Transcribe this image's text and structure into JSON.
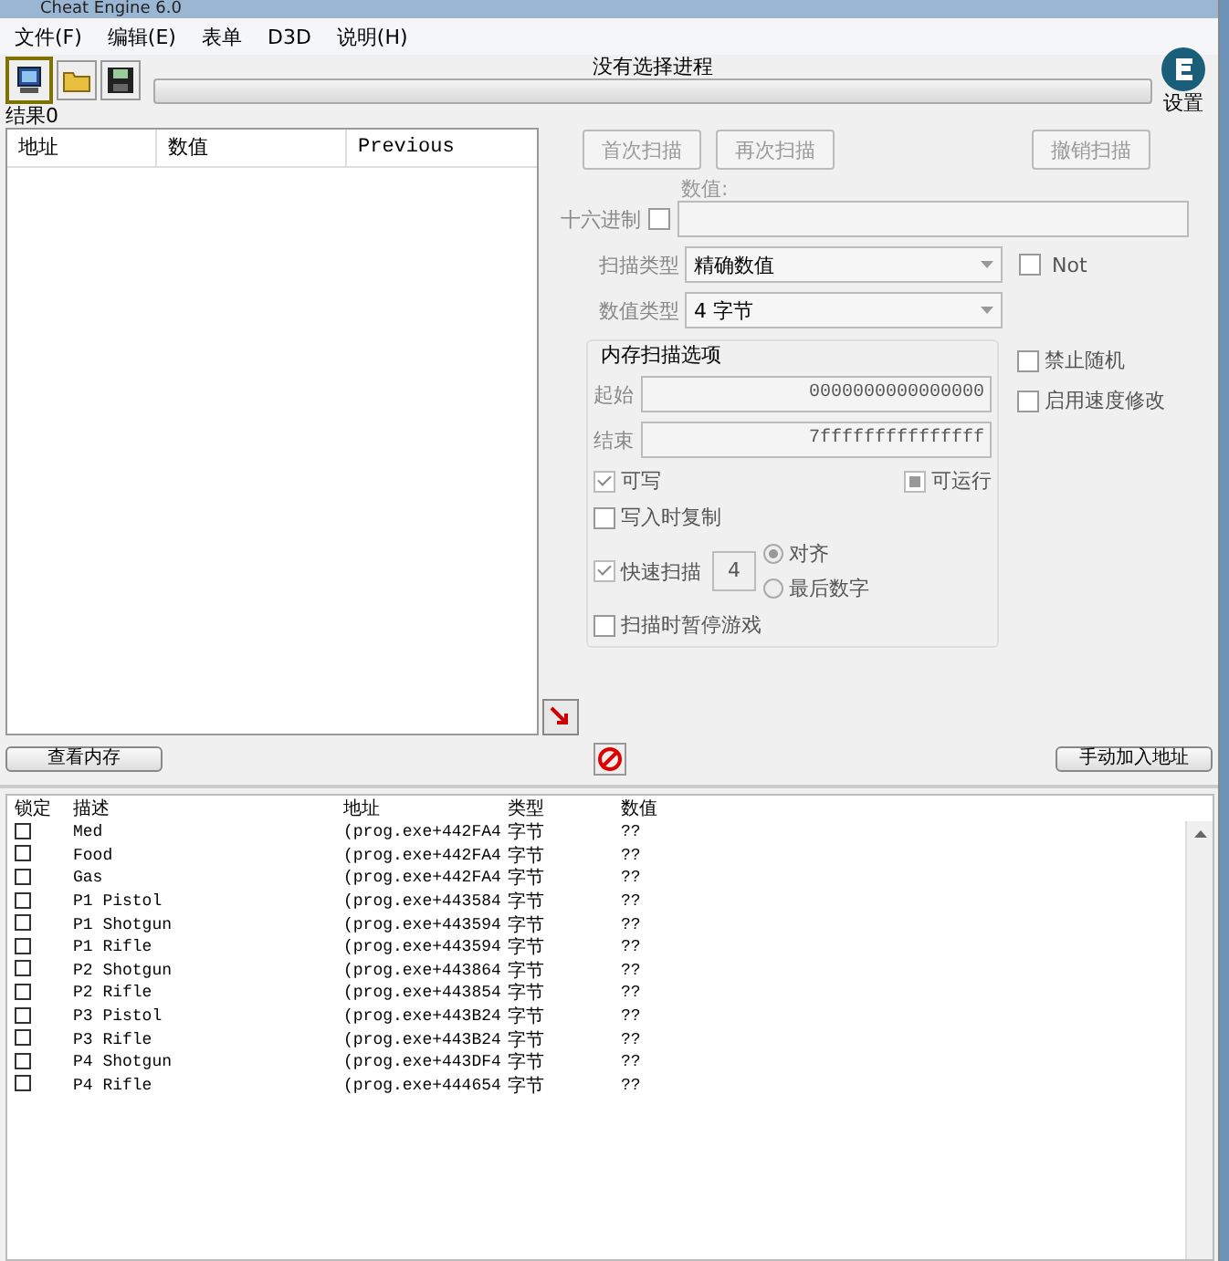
{
  "window": {
    "title": "Cheat Engine 6.0"
  },
  "menu": [
    "文件(F)",
    "编辑(E)",
    "表单",
    "D3D",
    "说明(H)"
  ],
  "process_label": "没有选择进程",
  "settings_label": "设置",
  "results_label": "结果0",
  "found_list": {
    "columns": [
      "地址",
      "数值",
      "Previous"
    ]
  },
  "scan_buttons": [
    {
      "label": "首次扫描",
      "disabled": true
    },
    {
      "label": "再次扫描",
      "disabled": true
    },
    {
      "label": "撤销扫描",
      "disabled": true
    }
  ],
  "value": {
    "label": "数值:"
  },
  "progress": {
    "level": 0
  },
  "hex": {
    "label": "十六进制",
    "checked": false
  },
  "scan_type": {
    "label": "扫描类型",
    "value": "精确数值"
  },
  "not_option": {
    "label": "Not",
    "checked": false
  },
  "value_type": {
    "label": "数值类型",
    "value": "4 字节"
  },
  "memory_options": {
    "title": "内存扫描选项",
    "start_label": "起始",
    "start": "0000000000000000",
    "end_label": "结束",
    "end": "7fffffffffffffff",
    "writable": {
      "label": "可写",
      "checked": true
    },
    "executable": {
      "label": "可运行",
      "indeterminate": true
    },
    "copy_on_write": {
      "label": "写入时复制",
      "checked": false
    },
    "fast_scan": {
      "label": "快速扫描",
      "checked": true,
      "value": "4"
    },
    "alignment": [
      {
        "label": "对齐",
        "selected": true
      },
      {
        "label": "最后数字",
        "selected": false
      }
    ],
    "pause_game": {
      "label": "扫描时暂停游戏",
      "checked": false
    }
  },
  "extra_options": [
    {
      "label": "禁止随机",
      "checked": false
    },
    {
      "label": "启用速度修改",
      "checked": false
    }
  ],
  "view_memory": "查看内存",
  "add_address": "手动加入地址",
  "address_table": {
    "columns": [
      "锁定",
      "描述",
      "地址",
      "类型",
      "数值"
    ],
    "rows": [
      {
        "active": false,
        "description": "Med",
        "address": "(prog.exe+442FA4",
        "type": "字节",
        "value": "??"
      },
      {
        "active": false,
        "description": "Food",
        "address": "(prog.exe+442FA4",
        "type": "字节",
        "value": "??"
      },
      {
        "active": false,
        "description": "Gas",
        "address": "(prog.exe+442FA4",
        "type": "字节",
        "value": "??"
      },
      {
        "active": false,
        "description": "P1 Pistol",
        "address": "(prog.exe+443584",
        "type": "字节",
        "value": "??"
      },
      {
        "active": false,
        "description": "P1 Shotgun",
        "address": "(prog.exe+443594",
        "type": "字节",
        "value": "??"
      },
      {
        "active": false,
        "description": "P1 Rifle",
        "address": "(prog.exe+443594",
        "type": "字节",
        "value": "??"
      },
      {
        "active": false,
        "description": "P2 Shotgun",
        "address": "(prog.exe+443864",
        "type": "字节",
        "value": "??"
      },
      {
        "active": false,
        "description": "P2 Rifle",
        "address": "(prog.exe+443854",
        "type": "字节",
        "value": "??"
      },
      {
        "active": false,
        "description": "P3 Pistol",
        "address": "(prog.exe+443B24",
        "type": "字节",
        "value": "??"
      },
      {
        "active": false,
        "description": "P3 Rifle",
        "address": "(prog.exe+443B24",
        "type": "字节",
        "value": "??"
      },
      {
        "active": false,
        "description": "P4 Shotgun",
        "address": "(prog.exe+443DF4",
        "type": "字节",
        "value": "??"
      },
      {
        "active": false,
        "description": "P4 Rifle",
        "address": "(prog.exe+444654",
        "type": "字节",
        "value": "??"
      }
    ]
  }
}
